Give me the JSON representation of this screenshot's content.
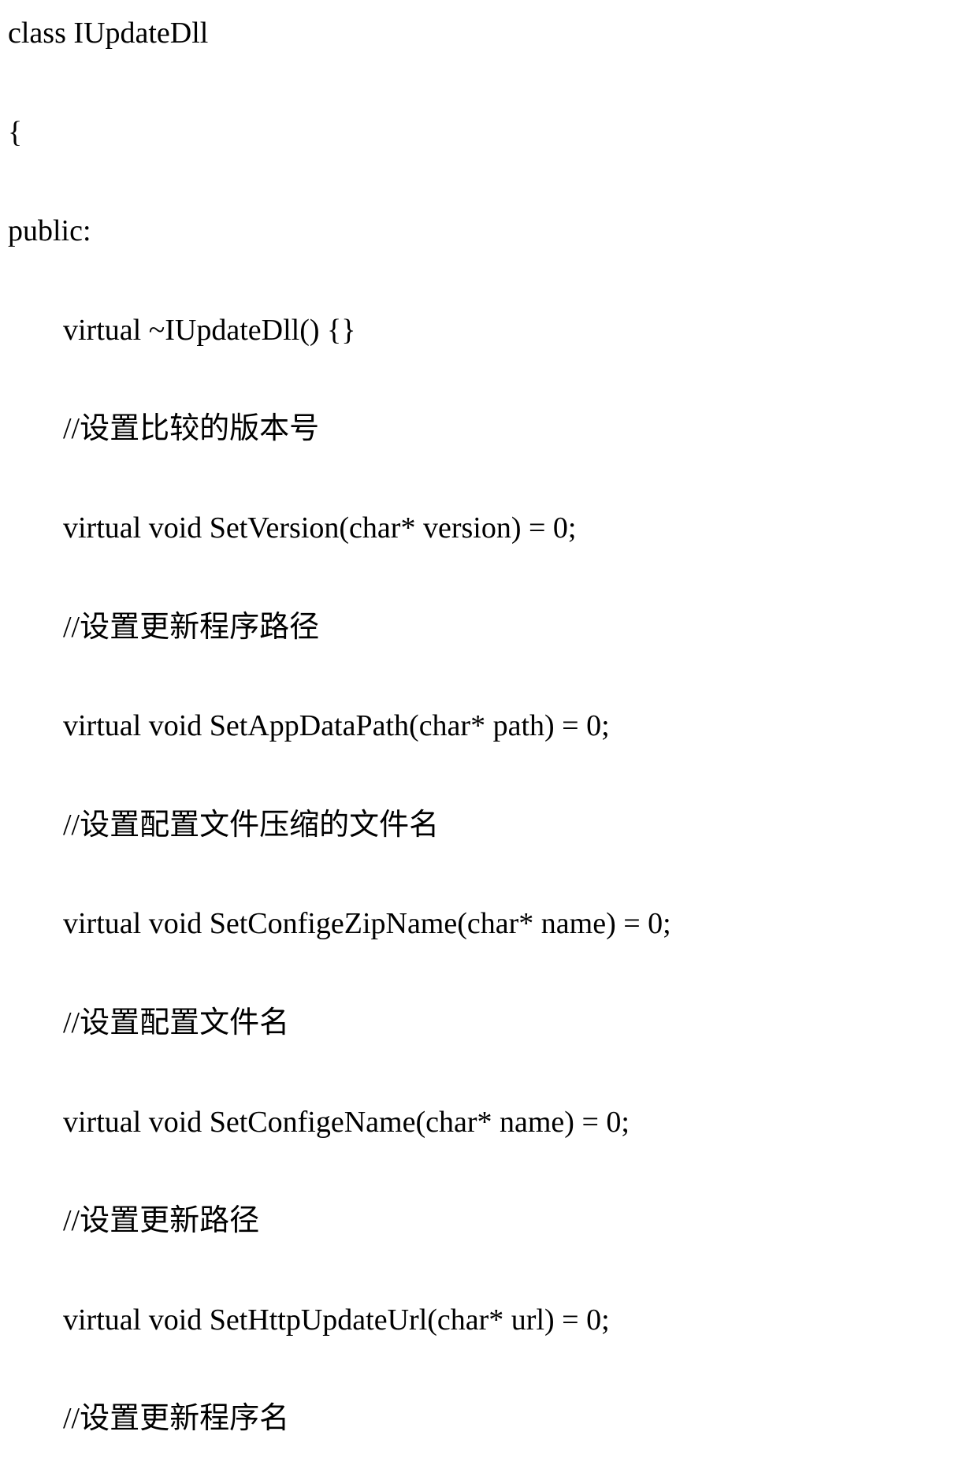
{
  "lines": [
    {
      "indent": false,
      "text": "class IUpdateDll"
    },
    {
      "indent": false,
      "text": "{"
    },
    {
      "indent": false,
      "text": "public:"
    },
    {
      "indent": true,
      "text": "virtual ~IUpdateDll() {}"
    },
    {
      "indent": true,
      "text": "//设置比较的版本号"
    },
    {
      "indent": true,
      "text": "virtual void SetVersion(char* version) = 0;"
    },
    {
      "indent": true,
      "text": "//设置更新程序路径"
    },
    {
      "indent": true,
      "text": "virtual void SetAppDataPath(char* path) = 0;"
    },
    {
      "indent": true,
      "text": "//设置配置文件压缩的文件名"
    },
    {
      "indent": true,
      "text": "virtual void SetConfigeZipName(char* name) = 0;"
    },
    {
      "indent": true,
      "text": "//设置配置文件名"
    },
    {
      "indent": true,
      "text": "virtual void SetConfigeName(char* name) = 0;"
    },
    {
      "indent": true,
      "text": "//设置更新路径"
    },
    {
      "indent": true,
      "text": "virtual void SetHttpUpdateUrl(char* url) = 0;"
    },
    {
      "indent": true,
      "text": "//设置更新程序名"
    }
  ]
}
